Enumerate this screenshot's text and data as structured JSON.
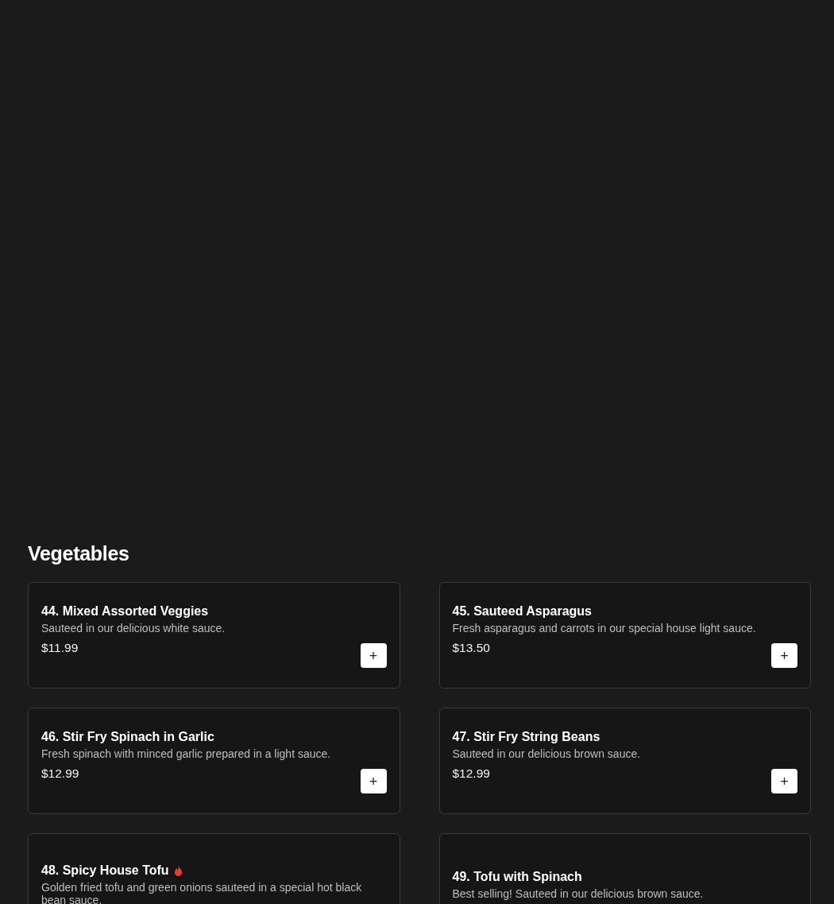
{
  "section": {
    "title": "Vegetables"
  },
  "items": [
    {
      "name": "44. Mixed Assorted Veggies",
      "spicy": false,
      "description": "Sauteed in our delicious white sauce.",
      "price": "$11.99",
      "add_button": "+"
    },
    {
      "name": "45. Sauteed Asparagus",
      "spicy": false,
      "description": "Fresh asparagus and carrots in our special house light sauce.",
      "price": "$13.50",
      "add_button": "+"
    },
    {
      "name": "46. Stir Fry Spinach in Garlic",
      "spicy": false,
      "description": "Fresh spinach with minced garlic prepared in a light sauce.",
      "price": "$12.99",
      "add_button": "+"
    },
    {
      "name": "47. Stir Fry String Beans",
      "spicy": false,
      "description": "Sauteed in our delicious brown sauce.",
      "price": "$12.99",
      "add_button": "+"
    },
    {
      "name": "48. Spicy House Tofu",
      "spicy": true,
      "description": "Golden fried tofu and green onions sauteed in a special hot black bean sauce."
    },
    {
      "name": "49. Tofu with Spinach",
      "spicy": false,
      "description": "Best selling! Sauteed in our delicious brown sauce."
    }
  ]
}
